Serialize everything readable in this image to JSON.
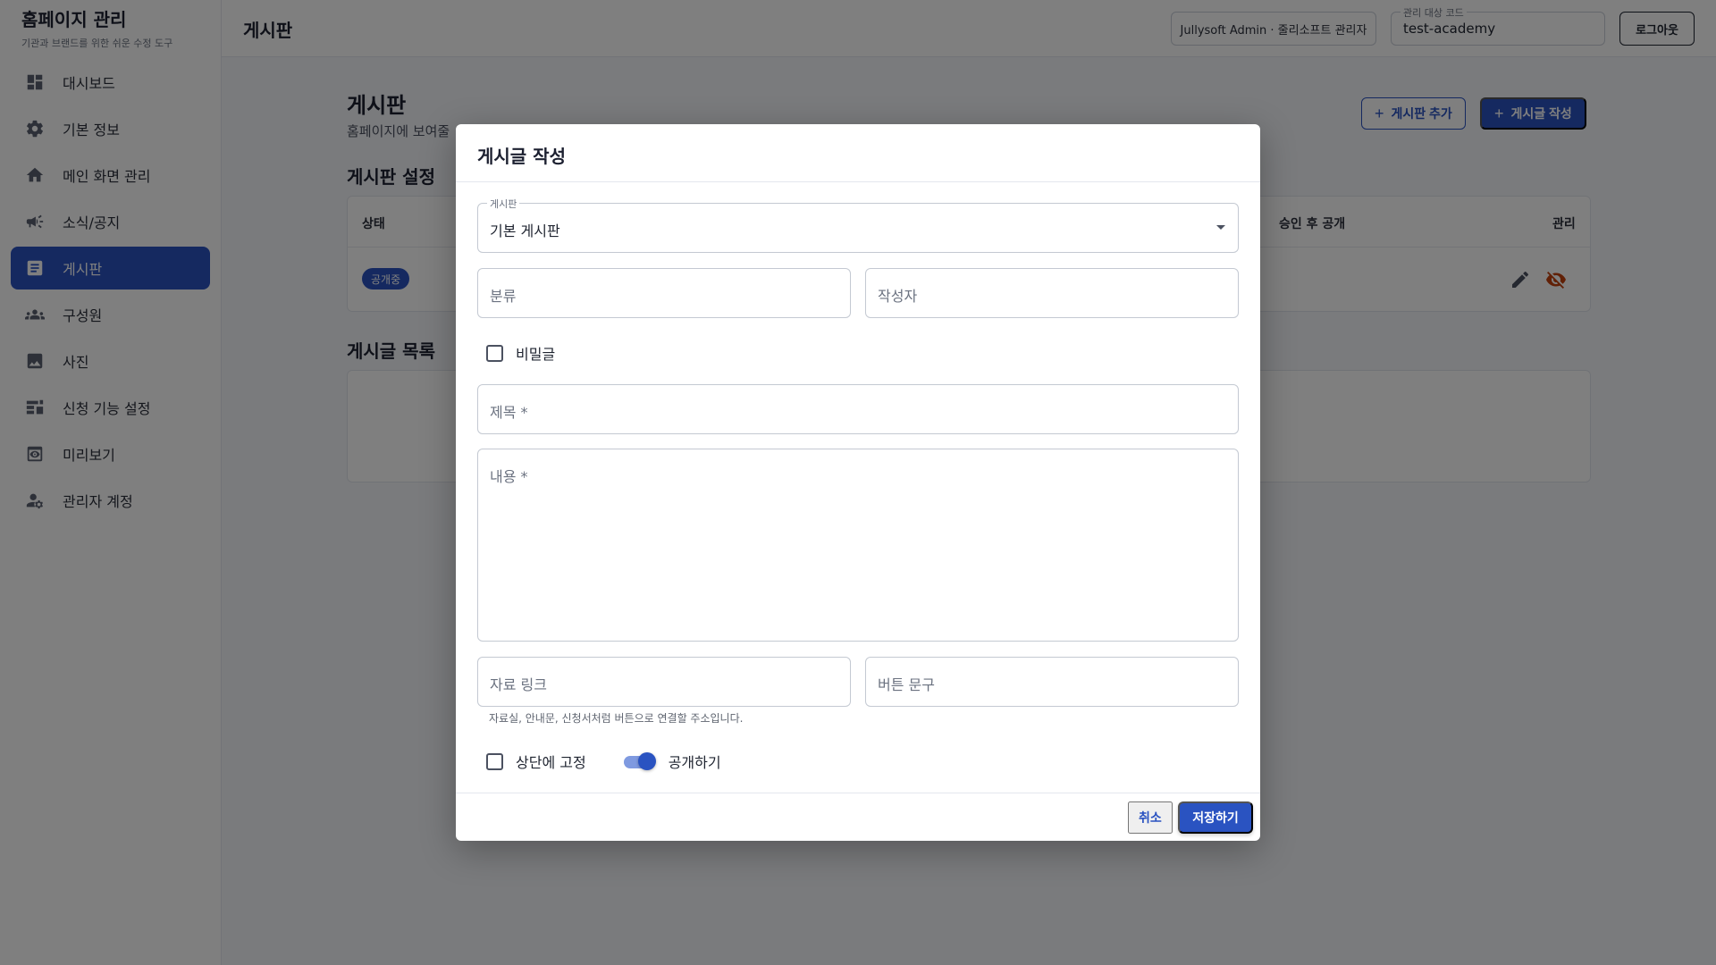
{
  "sidebar": {
    "title": "홈페이지 관리",
    "subtitle": "기관과 브랜드를 위한 쉬운 수정 도구",
    "items": [
      {
        "label": "대시보드",
        "icon": "dashboard-icon"
      },
      {
        "label": "기본 정보",
        "icon": "gear-icon"
      },
      {
        "label": "메인 화면 관리",
        "icon": "home-icon"
      },
      {
        "label": "소식/공지",
        "icon": "megaphone-icon"
      },
      {
        "label": "게시판",
        "icon": "article-icon",
        "active": true
      },
      {
        "label": "구성원",
        "icon": "group-icon"
      },
      {
        "label": "사진",
        "icon": "image-icon"
      },
      {
        "label": "신청 기능 설정",
        "icon": "form-settings-icon"
      },
      {
        "label": "미리보기",
        "icon": "preview-icon"
      },
      {
        "label": "관리자 계정",
        "icon": "admin-user-icon"
      }
    ]
  },
  "topbar": {
    "title": "게시판",
    "user": "Jullysoft Admin · 줄리소프트 관리자",
    "code_label": "관리 대상 코드",
    "code_value": "test-academy",
    "logout": "로그아웃"
  },
  "page": {
    "title": "게시판",
    "description": "홈페이지에 보여줄",
    "add_board": "게시판 추가",
    "write_post": "게시글 작성",
    "settings_title": "게시판 설정",
    "table_headers": {
      "status": "상태",
      "approval": "승인 후 공개",
      "manage": "관리"
    },
    "row_badge": "공개중",
    "list_title": "게시글 목록"
  },
  "modal": {
    "title": "게시글 작성",
    "board_label": "게시판",
    "board_value": "기본 게시판",
    "category_placeholder": "분류",
    "author_placeholder": "작성자",
    "secret_label": "비밀글",
    "title_placeholder": "제목 *",
    "content_placeholder": "내용 *",
    "link_placeholder": "자료 링크",
    "button_text_placeholder": "버튼 문구",
    "helper_text": "자료실, 안내문, 신청서처럼 버튼으로 연결할 주소입니다.",
    "pin_label": "상단에 고정",
    "public_label": "공개하기",
    "public_enabled": true,
    "cancel": "취소",
    "save": "저장하기"
  },
  "colors": {
    "accent": "#2a53c1",
    "warning_icon": "#c2410c"
  }
}
